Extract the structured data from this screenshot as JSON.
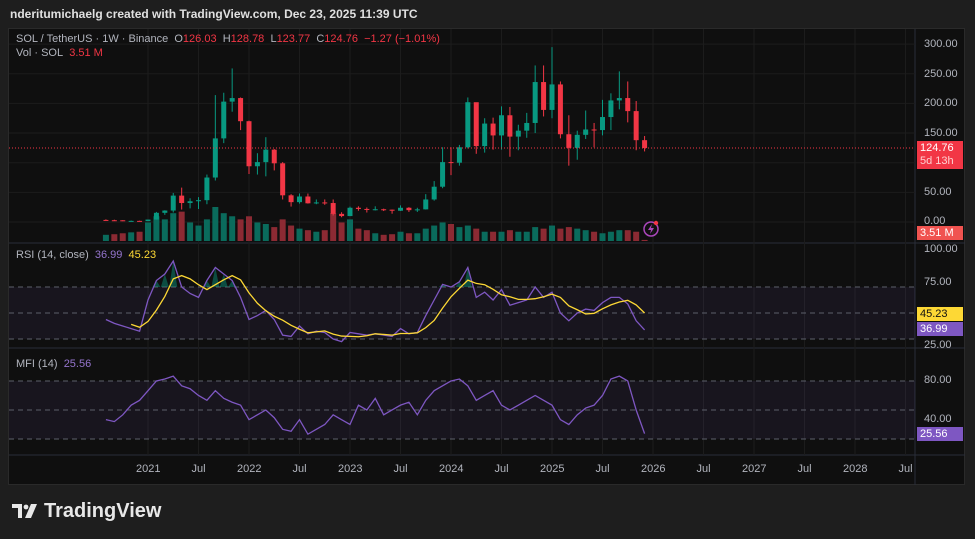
{
  "header": {
    "created": "nderitumichaelg created with TradingView.com, Dec 23, 2025 11:39 UTC"
  },
  "legend": {
    "symbol": "SOL / TetherUS · 1W · Binance",
    "o_label": "O",
    "o": "126.03",
    "h_label": "H",
    "h": "128.78",
    "l_label": "L",
    "l": "123.77",
    "c_label": "C",
    "c": "124.76",
    "change": "−1.27 (−1.01%)",
    "vol_label": "Vol · SOL",
    "vol": "3.51 M"
  },
  "price_axis": {
    "ticks": [
      "300.00",
      "250.00",
      "200.00",
      "150.00",
      "50.00",
      "0.00"
    ],
    "last_price": "124.76",
    "countdown": "5d 13h",
    "volume_badge": "3.51 M"
  },
  "rsi": {
    "label": "RSI (14, close)",
    "value": "36.99",
    "ma_value": "45.23",
    "ticks": [
      "100.00",
      "75.00",
      "25.00"
    ]
  },
  "mfi": {
    "label": "MFI (14)",
    "value": "25.56",
    "ticks": [
      "80.00",
      "40.00"
    ]
  },
  "x_axis": {
    "ticks": [
      "2021",
      "Jul",
      "2022",
      "Jul",
      "2023",
      "Jul",
      "2024",
      "Jul",
      "2025",
      "Jul",
      "2026",
      "Jul",
      "2027",
      "Jul",
      "2028",
      "Jul"
    ]
  },
  "logo": {
    "text": "TradingView"
  },
  "colors": {
    "up": "#089981",
    "down": "#f23645",
    "rsi": "#7e57c2",
    "rsi_ma": "#fdd835",
    "mfi": "#7e57c2"
  },
  "icons": {
    "flash": "lightning-icon"
  },
  "chart_data": {
    "type": "candlestick",
    "symbol": "SOL / TetherUS",
    "interval": "1W",
    "start": "2020-08",
    "step": "month",
    "ylim": [
      0,
      300
    ],
    "close": [
      3.0,
      2.9,
      1.6,
      1.9,
      1.5,
      4.1,
      15.5,
      19.3,
      44.5,
      32,
      35,
      36.8,
      75,
      141,
      203,
      209,
      170,
      94,
      101,
      122,
      99,
      45,
      33.5,
      43,
      31.5,
      33,
      32,
      13.7,
      10,
      24,
      22,
      20.8,
      21.5,
      20.8,
      19,
      24,
      20,
      21.3,
      38,
      59.5,
      101,
      100,
      126,
      202,
      128,
      166,
      146,
      180,
      144,
      154,
      167,
      236,
      189,
      232,
      148,
      125,
      147,
      156,
      155,
      177,
      205,
      209,
      187,
      138,
      124.76
    ],
    "high": [
      4.5,
      3.9,
      3.0,
      2.4,
      2.2,
      4.3,
      17,
      19.8,
      49,
      58,
      40,
      42,
      80,
      214,
      218,
      259,
      210,
      171,
      116,
      143,
      123,
      101,
      47,
      48,
      48,
      38,
      38,
      38,
      16.5,
      26,
      26.5,
      24.5,
      26.5,
      22.5,
      21,
      28,
      25,
      24,
      47,
      69,
      126,
      126,
      130,
      210,
      180,
      175,
      176,
      195,
      194,
      164,
      184,
      264,
      264,
      295,
      237,
      180,
      154,
      188,
      167,
      206,
      217,
      254,
      237,
      204,
      145
    ],
    "low": [
      2.5,
      2.3,
      1.5,
      1.3,
      1.4,
      1.5,
      4,
      12,
      16,
      21,
      23,
      22,
      30,
      70,
      133,
      186,
      155,
      81,
      80,
      77,
      87,
      38,
      26,
      31,
      31,
      30,
      29,
      11,
      8,
      9.9,
      19,
      16,
      19.5,
      18.5,
      14,
      18.5,
      17,
      17,
      21,
      36,
      57,
      79,
      95,
      124,
      115,
      117,
      122,
      122,
      110,
      121,
      142,
      150,
      178,
      175,
      141,
      95,
      105,
      140,
      126,
      146,
      155,
      190,
      168,
      121,
      119
    ],
    "volume": [
      20,
      22,
      25,
      28,
      30,
      60,
      80,
      70,
      90,
      95,
      60,
      50,
      70,
      110,
      90,
      80,
      70,
      80,
      60,
      55,
      45,
      70,
      50,
      40,
      35,
      30,
      35,
      90,
      60,
      70,
      40,
      35,
      25,
      20,
      22,
      30,
      25,
      25,
      40,
      50,
      60,
      55,
      45,
      50,
      40,
      30,
      30,
      30,
      35,
      30,
      30,
      45,
      40,
      50,
      40,
      45,
      40,
      35,
      30,
      25,
      30,
      35,
      35,
      30,
      3.51
    ],
    "rsi": [
      45,
      42,
      40,
      38,
      36,
      60,
      75,
      80,
      90,
      70,
      65,
      62,
      75,
      85,
      80,
      75,
      62,
      45,
      48,
      52,
      45,
      33,
      32,
      40,
      34,
      36,
      35,
      30,
      28,
      35,
      34,
      33,
      34,
      33,
      32,
      38,
      34,
      35,
      48,
      60,
      72,
      70,
      74,
      85,
      62,
      66,
      60,
      68,
      56,
      58,
      60,
      70,
      62,
      66,
      50,
      44,
      50,
      53,
      52,
      58,
      62,
      62,
      57,
      44,
      36.99
    ],
    "rsi_levels": [
      70,
      50,
      30
    ],
    "mfi": [
      40,
      38,
      45,
      55,
      60,
      70,
      80,
      82,
      85,
      75,
      72,
      65,
      60,
      70,
      62,
      58,
      55,
      40,
      45,
      50,
      42,
      30,
      28,
      40,
      25,
      30,
      35,
      45,
      40,
      35,
      55,
      50,
      62,
      45,
      50,
      55,
      58,
      45,
      60,
      70,
      75,
      80,
      82,
      75,
      60,
      65,
      70,
      55,
      50,
      55,
      60,
      65,
      60,
      55,
      40,
      35,
      45,
      52,
      55,
      65,
      82,
      85,
      80,
      50,
      25.56
    ],
    "mfi_levels": [
      80,
      50,
      20
    ]
  }
}
